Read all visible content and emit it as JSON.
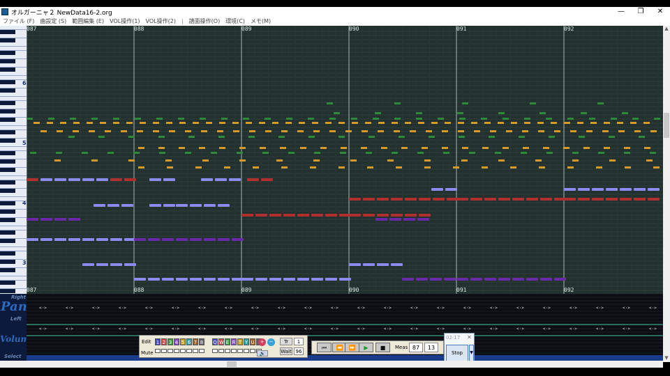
{
  "window": {
    "title": "オルガーニャ２ NewData16-2.org",
    "minimize": "—",
    "maximize": "❐",
    "close": "✕"
  },
  "menu": [
    "ファイル (F)",
    "曲設定 (S)",
    "範囲編集 (E)",
    "VOL操作(1)",
    "VOL操作(2)",
    "|",
    "譜面操作(O)",
    "環境(C)",
    "メモ(M)"
  ],
  "octave_labels": [
    "6",
    "5",
    "4",
    "3"
  ],
  "measures_top": [
    "087",
    "088",
    "089",
    "090",
    "091",
    "092"
  ],
  "measures_bottom": [
    "087",
    "088",
    "089",
    "090",
    "091",
    "092"
  ],
  "lower_labels": {
    "pan_right": "Right",
    "pan": "Pan",
    "pan_left": "Left",
    "volume": "Volume",
    "select": "Select"
  },
  "edit_panel": {
    "edit_label": "Edit",
    "mute_label": "Mute",
    "tracks": [
      "1",
      "2",
      "3",
      "4",
      "5",
      "6",
      "7",
      "8",
      "Q",
      "W",
      "E",
      "R",
      "T",
      "Y",
      "U",
      "I"
    ],
    "tr_label": "Tr",
    "tr_value": "1",
    "wait_label": "Wait",
    "wait_value": "96"
  },
  "transport": {
    "buttons": [
      "⏮",
      "⏪",
      "⏩",
      "▶",
      "■"
    ],
    "meas_label": "Meas",
    "meas_value": "87",
    "beat_value": "13"
  },
  "mini_player": {
    "time": "02:17",
    "close": "✕",
    "stop": "Stop",
    "drop": "▼"
  },
  "colors": {
    "score_bg": "#22302e",
    "note_blue": "#8a8cf0",
    "note_red": "#b03030",
    "note_purple": "#6a2aa8",
    "note_orange": "#d49a2a",
    "note_green": "#2e8a3a",
    "select_bar": "#1a3a8a"
  }
}
